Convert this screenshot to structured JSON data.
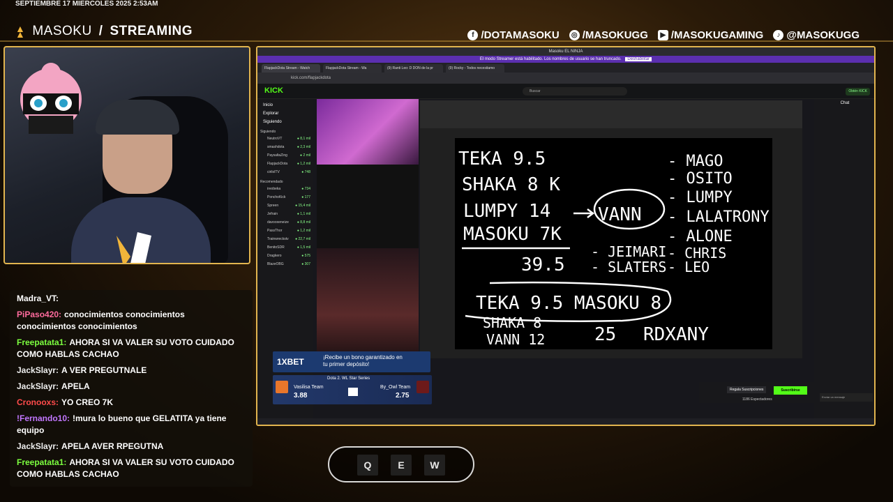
{
  "overlay": {
    "date": "SEPTIEMBRE 17 MIERCOLES 2025 2:53AM",
    "brand_name": "MASOKU",
    "brand_sep": "/",
    "brand_tag": "STREAMING",
    "socials": [
      {
        "icon": "facebook-icon",
        "label": "/DOTAMASOKU"
      },
      {
        "icon": "instagram-icon",
        "label": "/MASOKUGG"
      },
      {
        "icon": "youtube-icon",
        "label": "/MASOKUGAMING"
      },
      {
        "icon": "tiktok-icon",
        "label": "@MASOKUGG"
      }
    ]
  },
  "chat": [
    {
      "user": "Madra_VT:",
      "color": "#ffffff",
      "text": ""
    },
    {
      "user": "PiPaso420:",
      "color": "#ff6b9d",
      "text": "conocimientos conocimientos conocimientos conocimientos"
    },
    {
      "user": "Freepatata1:",
      "color": "#7cff3f",
      "text": "AHORA SI VA VALER SU VOTO CUIDADO COMO HABLAS CACHAO"
    },
    {
      "user": "JackSlayr:",
      "color": "#eeeeee",
      "text": "A VER PREGUTNALE"
    },
    {
      "user": "JackSlayr:",
      "color": "#eeeeee",
      "text": "APELA"
    },
    {
      "user": "Cronooxs:",
      "color": "#ff4b4b",
      "text": "YO CREO 7K"
    },
    {
      "user": "!Fernando10:",
      "color": "#c277ff",
      "text": "!mura lo bueno que GELATITA ya tiene equipo"
    },
    {
      "user": "JackSlayr:",
      "color": "#eeeeee",
      "text": "APELA AVER RPEGUTNA"
    },
    {
      "user": "Freepatata1:",
      "color": "#7cff3f",
      "text": "AHORA SI VA VALER SU VOTO CUIDADO COMO HABLAS CACHAO"
    }
  ],
  "browser": {
    "window_title": "Masoku EL NINJA",
    "banner": "El modo Streamer está habilitado. Los nombres de usuario se han truncado.",
    "banner_btn": "Deshabilitar",
    "tabs": [
      "FlapjackDota Stream - Watch",
      "FlapjackDota Stream - Wa",
      "(9) Ranti Leo: D DON de la pr",
      "(9) Rocky - Todos necesitamo"
    ],
    "url": "kick.com/flapjackdota",
    "search_placeholder": "Buscar",
    "login": "Obtén KICK",
    "nav": [
      "Inicio",
      "Explorar",
      "Siguiendo"
    ],
    "following_label": "Siguiendo",
    "channels": [
      {
        "name": "NeutroVT",
        "v": "8,1 mil"
      },
      {
        "name": "smashdota",
        "v": "2,3 mil"
      },
      {
        "name": "PaysaltaZing",
        "v": "2 mil"
      },
      {
        "name": "FlapjackDota",
        "v": "1,2 mil"
      },
      {
        "name": "cirilolTV",
        "v": "748"
      }
    ],
    "recommended_label": "Recomendado",
    "rec": [
      {
        "name": "ireobeka",
        "v": "734"
      },
      {
        "name": "PonchoKick",
        "v": "177"
      },
      {
        "name": "Spreen",
        "v": "15,4 mil"
      },
      {
        "name": "Jefrain",
        "v": "1,1 mil"
      },
      {
        "name": "davooxeneize",
        "v": "8,8 mil"
      },
      {
        "name": "PassThor",
        "v": "1,2 mil"
      },
      {
        "name": "Trainwreckstv",
        "v": "22,7 mil"
      },
      {
        "name": "BenitoSDR",
        "v": "1,5 mil"
      },
      {
        "name": "Dragkero",
        "v": "575"
      },
      {
        "name": "BlazeOBG",
        "v": "307"
      }
    ],
    "chat_title": "Chat",
    "subscribe": "Suscribirse",
    "gift": "Regala Suscripciones",
    "viewers": "1186 Espectadores",
    "send_placeholder": "Enviar un mensaje"
  },
  "ad": {
    "brand": "1XBET",
    "text": "¡Recibe un bono garantizado en tu primer depósito!",
    "series": "Dota 2. WL Star Series",
    "team1": "Vasilisa Team",
    "odds1": "3.88",
    "team2": "By_Owl Team",
    "odds2": "2.75"
  },
  "whiteboard": {
    "left": [
      "TEKA 9.5",
      "SHAKA 8 K",
      "LUMPY 14",
      "MASOKU 7K",
      "39.5"
    ],
    "center": "VANN",
    "right": [
      "- MAGO",
      "- OSITO",
      "- LUMPY",
      "- LALATRONY",
      "- ALONE",
      "- CHRIS",
      "- LEO"
    ],
    "mid": [
      "- JEIMARI",
      "- SLATERS"
    ],
    "bottom1": "TEKA 9.5 MASOKU 8",
    "bottom2": [
      "SHAKA 8",
      "VANN 12"
    ],
    "bottom_total": "25",
    "bottom_name": "RDXANY"
  },
  "gallery": [
    "Q",
    "E",
    "W"
  ]
}
